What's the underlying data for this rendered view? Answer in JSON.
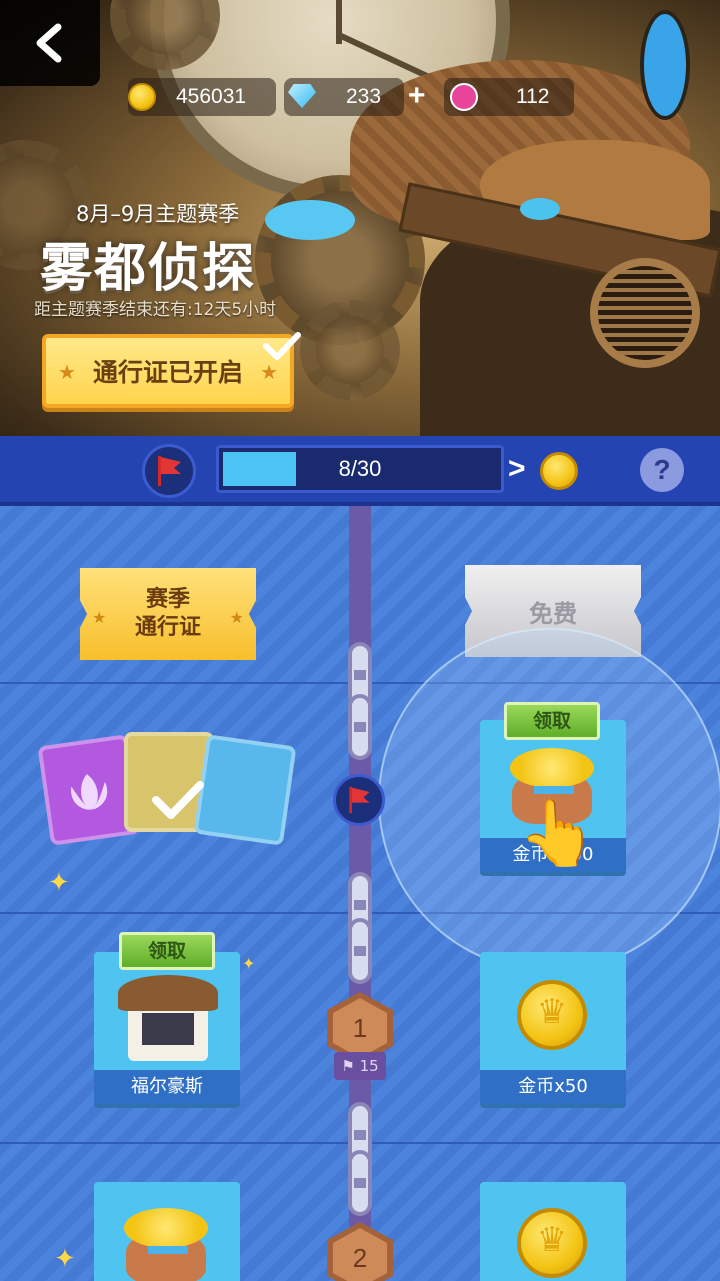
{
  "header": {
    "resources": {
      "coins": "456031",
      "gems": "233",
      "lotus": "112"
    },
    "plus_symbol": "+"
  },
  "season": {
    "range": "8月–9月主题赛季",
    "title": "雾都侦探",
    "countdown": "距主题赛季结束还有:12天5小时",
    "pass_button": "通行证已开启"
  },
  "progress": {
    "text": "8/30",
    "fraction": 0.267,
    "chevron": ">",
    "help": "?"
  },
  "tracks": {
    "premium_label": "赛季\n通行证",
    "free_label": "免费"
  },
  "rewards": {
    "claim_label": "领取",
    "free_row1_caption": "金币x100",
    "premium_row2_caption": "福尔豪斯",
    "free_row2_caption": "金币x50"
  },
  "levels": {
    "one": "1",
    "two": "2",
    "tag": "15"
  },
  "colors": {
    "accent_blue": "#2444b2",
    "gold": "#f3c414",
    "claim_green": "#5fae2a"
  },
  "icons": [
    "back-arrow-icon",
    "coin-icon",
    "gem-icon",
    "lotus-icon",
    "flag-icon",
    "help-icon",
    "check-icon",
    "pointer-hand-icon"
  ]
}
